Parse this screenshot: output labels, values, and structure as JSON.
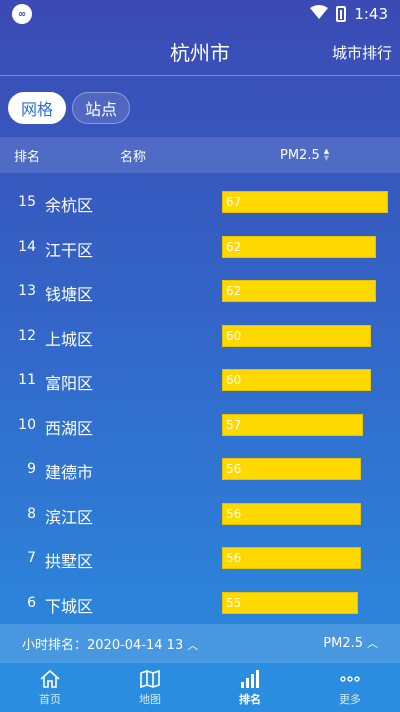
{
  "status": {
    "time": "1:43"
  },
  "header": {
    "title": "杭州市",
    "action": "城市排行"
  },
  "toggle": {
    "grid": "网格",
    "station": "站点"
  },
  "table_header": {
    "rank": "排名",
    "name": "名称",
    "metric": "PM2.5"
  },
  "rows": [
    {
      "rank": "15",
      "name": "余杭区",
      "value": 67
    },
    {
      "rank": "14",
      "name": "江干区",
      "value": 62
    },
    {
      "rank": "13",
      "name": "钱塘区",
      "value": 62
    },
    {
      "rank": "12",
      "name": "上城区",
      "value": 60
    },
    {
      "rank": "11",
      "name": "富阳区",
      "value": 60
    },
    {
      "rank": "10",
      "name": "西湖区",
      "value": 57
    },
    {
      "rank": "9",
      "name": "建德市",
      "value": 56
    },
    {
      "rank": "8",
      "name": "滨江区",
      "value": 56
    },
    {
      "rank": "7",
      "name": "拱墅区",
      "value": 56
    },
    {
      "rank": "6",
      "name": "下城区",
      "value": 55
    }
  ],
  "info_bar": {
    "left": "小时排名：2020-04-14 13",
    "right": "PM2.5"
  },
  "nav": [
    {
      "label": "首页",
      "icon": "home-icon"
    },
    {
      "label": "地图",
      "icon": "map-icon"
    },
    {
      "label": "排名",
      "icon": "ranking-icon"
    },
    {
      "label": "更多",
      "icon": "more-icon"
    }
  ],
  "colors": {
    "bar": "#ffd800",
    "accent": "#2f6fd0"
  }
}
